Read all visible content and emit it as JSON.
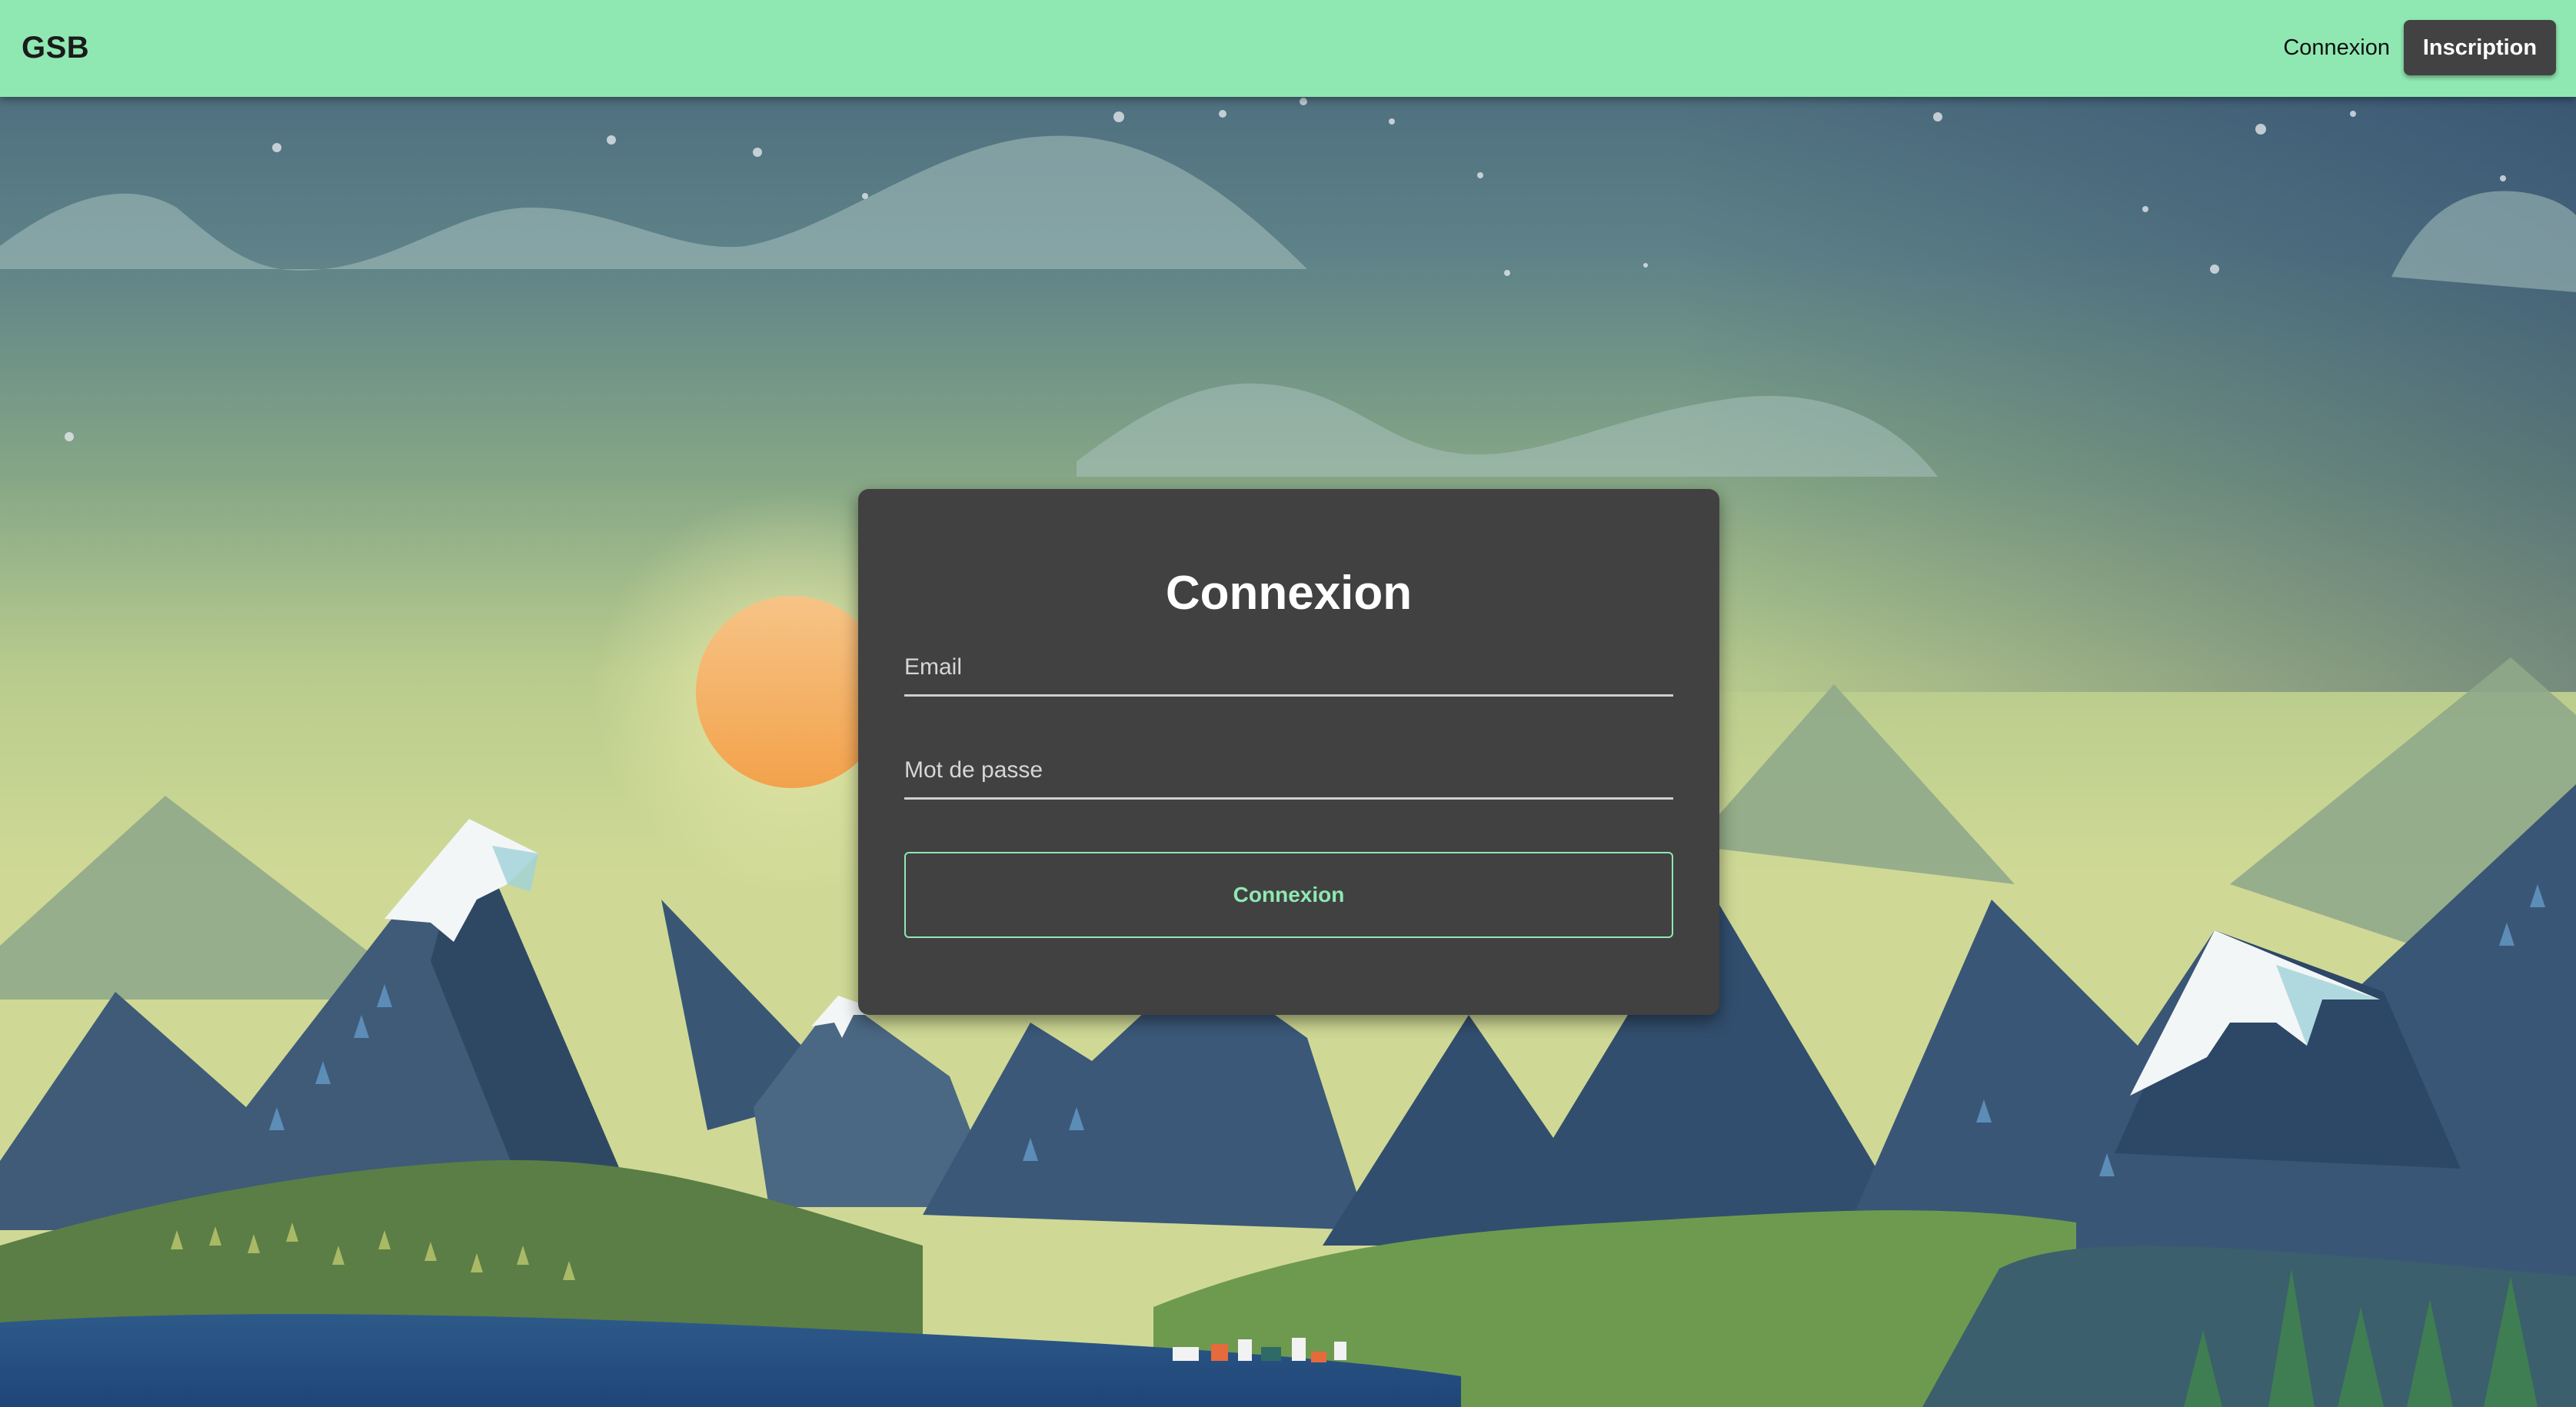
{
  "navbar": {
    "brand": "GSB",
    "login_link": "Connexion",
    "signup_button": "Inscription"
  },
  "login_card": {
    "title": "Connexion",
    "email_placeholder": "Email",
    "email_value": "",
    "password_placeholder": "Mot de passe",
    "password_value": "",
    "submit_label": "Connexion"
  },
  "colors": {
    "navbar_bg": "#8fe8b2",
    "card_bg": "#414141",
    "accent": "#8fe8b2",
    "signup_button_bg": "#424242"
  },
  "background": {
    "illustration": "mountain-landscape-illustration"
  }
}
